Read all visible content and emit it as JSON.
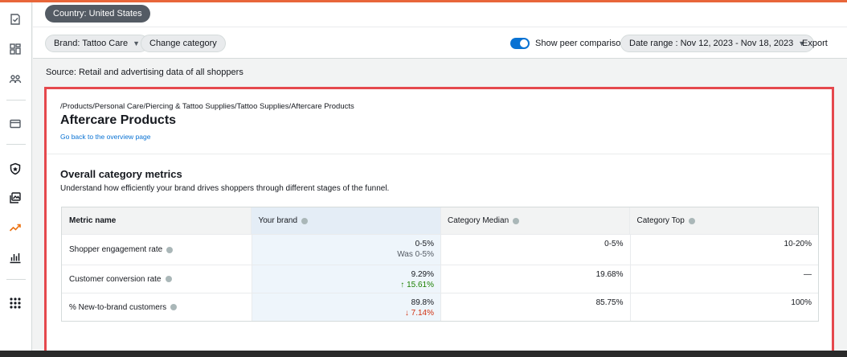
{
  "header": {
    "country_pill": "Country: United States",
    "brand_pill": "Brand: Tattoo Care",
    "change_category": "Change category",
    "peer_toggle_label": "Show peer comparison",
    "date_range": "Date range : Nov 12, 2023 - Nov 18, 2023",
    "export": "Export",
    "peer_toggle_on": true
  },
  "source_text": "Source: Retail and advertising data of all shoppers",
  "category": {
    "breadcrumb": "/Products/Personal Care/Piercing & Tattoo Supplies/Tattoo Supplies/Aftercare Products",
    "title": "Aftercare Products",
    "back_link": "Go back to the overview page"
  },
  "metrics": {
    "title": "Overall category metrics",
    "description": "Understand how efficiently your brand drives shoppers through different stages of the funnel.",
    "columns": [
      "Metric name",
      "Your brand",
      "Category Median",
      "Category Top"
    ],
    "rows": [
      {
        "name": "Shopper engagement rate",
        "brand": "0-5%",
        "brand_sub": "Was 0-5%",
        "median": "0-5%",
        "top": "10-20%"
      },
      {
        "name": "Customer conversion rate",
        "brand": "9.29%",
        "brand_sub": "↑ 15.61%",
        "median": "19.68%",
        "top": "—"
      },
      {
        "name": "% New-to-brand customers",
        "brand": "89.8%",
        "brand_sub": "↓ 7.14%",
        "median": "85.75%",
        "top": "100%"
      }
    ]
  },
  "colors": {
    "accent": "#0972d3",
    "highlight_border": "#e5484d",
    "up": "#1d8102",
    "down": "#d13212"
  },
  "sidebar_icons": [
    "checklist-icon",
    "dashboard-grid-icon",
    "audience-icon",
    "wallet-icon",
    "shield-icon",
    "media-icon",
    "trend-icon",
    "bar-chart-icon",
    "apps-grid-icon"
  ]
}
